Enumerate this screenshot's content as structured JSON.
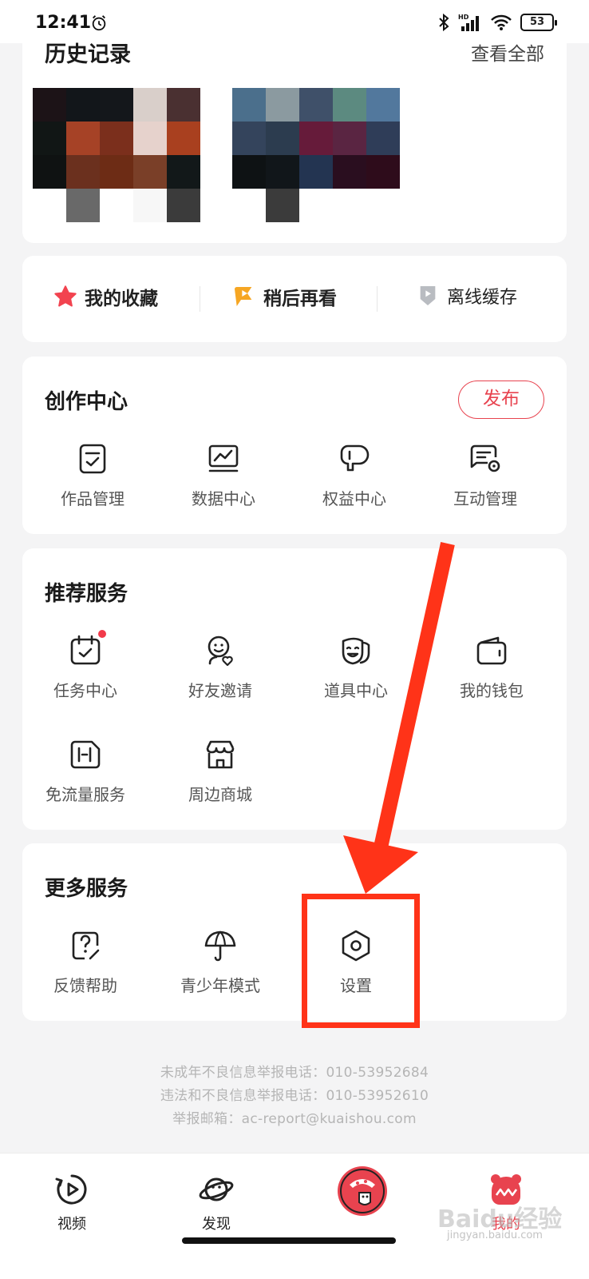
{
  "status_bar": {
    "time": "12:41",
    "battery": "53",
    "network": "HD"
  },
  "history": {
    "title": "历史记录",
    "view_all": "查看全部",
    "thumb_a_colors": [
      "#1c1317",
      "#12161a",
      "#14171b",
      "#d9cfca",
      "#4a3031",
      "#111615",
      "#a64226",
      "#7b2f1c",
      "#e6d2cc",
      "#a9401f",
      "#0f1212",
      "#6b301e",
      "#6d2c15",
      "#7a3f28",
      "#121819",
      "#ffffff",
      "#696969",
      "#ffffff",
      "#f7f7f7",
      "#3b3b3b"
    ],
    "thumb_b_colors": [
      "#4b6f8c",
      "#8b9aa0",
      "#3f5069",
      "#5c8a80",
      "#52789d",
      "#34445c",
      "#2c3c4f",
      "#661b3a",
      "#5a2542",
      "#2f3d58",
      "#0e1214",
      "#11161a",
      "#233451",
      "#2a0e1f",
      "#2e0c1b",
      "#ffffff",
      "#3b3b3b",
      "#ffffff",
      "#ffffff",
      "#ffffff"
    ]
  },
  "quick": {
    "favorites": "我的收藏",
    "watch_later": "稍后再看",
    "offline": "离线缓存"
  },
  "creation": {
    "title": "创作中心",
    "publish": "发布",
    "items": [
      {
        "label": "作品管理",
        "icon": "works-manage-icon"
      },
      {
        "label": "数据中心",
        "icon": "data-center-icon"
      },
      {
        "label": "权益中心",
        "icon": "benefits-icon"
      },
      {
        "label": "互动管理",
        "icon": "interaction-manage-icon"
      }
    ]
  },
  "recommended": {
    "title": "推荐服务",
    "items": [
      {
        "label": "任务中心",
        "icon": "task-calendar-icon"
      },
      {
        "label": "好友邀请",
        "icon": "invite-friend-icon"
      },
      {
        "label": "道具中心",
        "icon": "props-mask-icon"
      },
      {
        "label": "我的钱包",
        "icon": "wallet-icon"
      },
      {
        "label": "免流量服务",
        "icon": "free-data-icon"
      },
      {
        "label": "周边商城",
        "icon": "shop-icon"
      }
    ]
  },
  "more": {
    "title": "更多服务",
    "items": [
      {
        "label": "反馈帮助",
        "icon": "feedback-help-icon"
      },
      {
        "label": "青少年模式",
        "icon": "umbrella-icon"
      },
      {
        "label": "设置",
        "icon": "settings-hexagon-icon"
      }
    ]
  },
  "footer": {
    "line1": "未成年不良信息举报电话：010-53952684",
    "line2": "违法和不良信息举报电话：010-53952610",
    "line3": "举报邮箱：ac-report@kuaishou.com"
  },
  "nav": {
    "video": "视频",
    "discover": "发现",
    "mine": "我的"
  },
  "watermark": {
    "brand": "Baidu经验",
    "url": "jingyan.baidu.com"
  },
  "colors": {
    "accent": "#e8434f",
    "annotation": "#ff3318",
    "watch_later": "#f6a623"
  }
}
